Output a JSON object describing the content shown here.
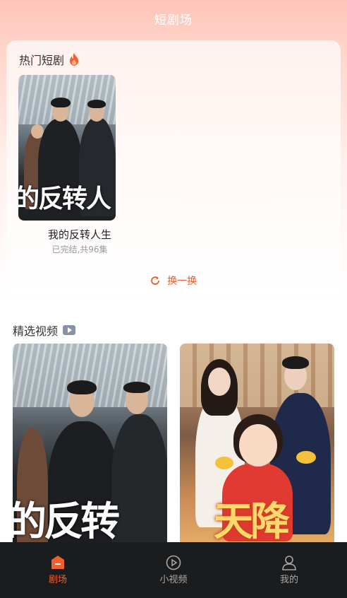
{
  "header": {
    "title": "短剧场"
  },
  "hot": {
    "title": "热门短剧",
    "drama": {
      "poster_text": "的反转人",
      "name": "我的反转人生",
      "status": "已完结,共96集"
    },
    "refresh_label": "换一换"
  },
  "selected": {
    "title": "精选视频",
    "cards": [
      {
        "poster_text": "的反转"
      },
      {
        "poster_text": "天降"
      }
    ]
  },
  "nav": {
    "items": [
      {
        "label": "剧场",
        "icon": "theater-icon",
        "active": true
      },
      {
        "label": "小视频",
        "icon": "play-circle-icon",
        "active": false
      },
      {
        "label": "我的",
        "icon": "user-icon",
        "active": false
      }
    ]
  },
  "colors": {
    "accent": "#f0602e",
    "nav_bg": "#1b1c1e",
    "nav_inactive": "#a8a8a8"
  }
}
